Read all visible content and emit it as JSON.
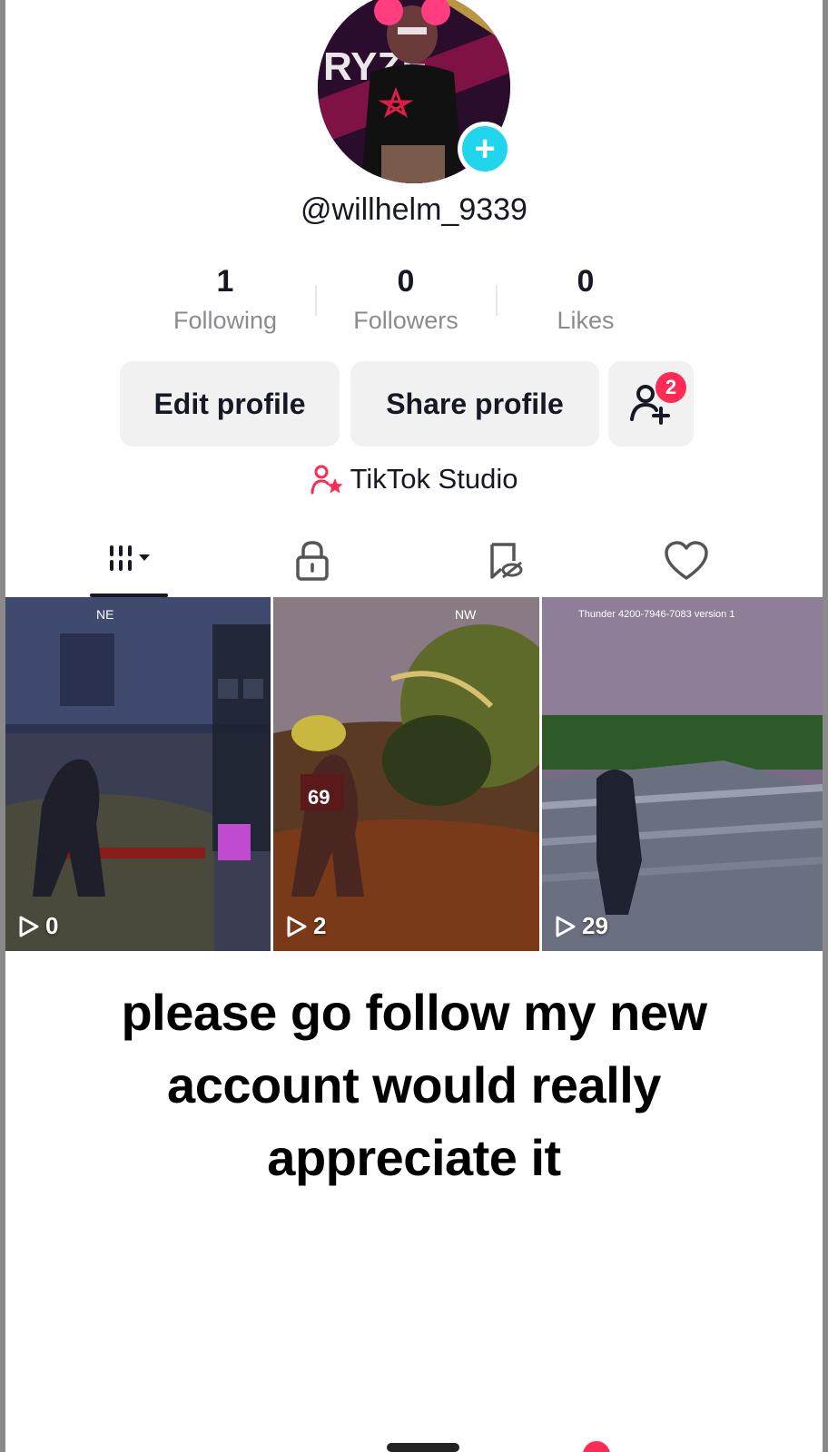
{
  "profile": {
    "username": "@willhelm_9339",
    "avatar_text": "RYZE"
  },
  "stats": [
    {
      "value": "1",
      "label": "Following"
    },
    {
      "value": "0",
      "label": "Followers"
    },
    {
      "value": "0",
      "label": "Likes"
    }
  ],
  "buttons": {
    "edit": "Edit profile",
    "share": "Share profile",
    "friends_badge": "2"
  },
  "studio": {
    "label": "TikTok Studio"
  },
  "tabs": [
    "videos-grid-icon",
    "lock-icon",
    "repost-hidden-icon",
    "heart-icon"
  ],
  "videos": [
    {
      "views": "0",
      "hud_text": "NE"
    },
    {
      "views": "2",
      "hud_text": "NW",
      "jersey": "69"
    },
    {
      "views": "29",
      "hud_text": "Thunder 4200-7946-7083 version 1"
    }
  ],
  "caption": "please go follow my new account would really appreciate it",
  "colors": {
    "accent_pink": "#fe2c55",
    "accent_cyan": "#20d5ec",
    "button_bg": "#f1f1f2",
    "muted_text": "#8a8b91"
  }
}
